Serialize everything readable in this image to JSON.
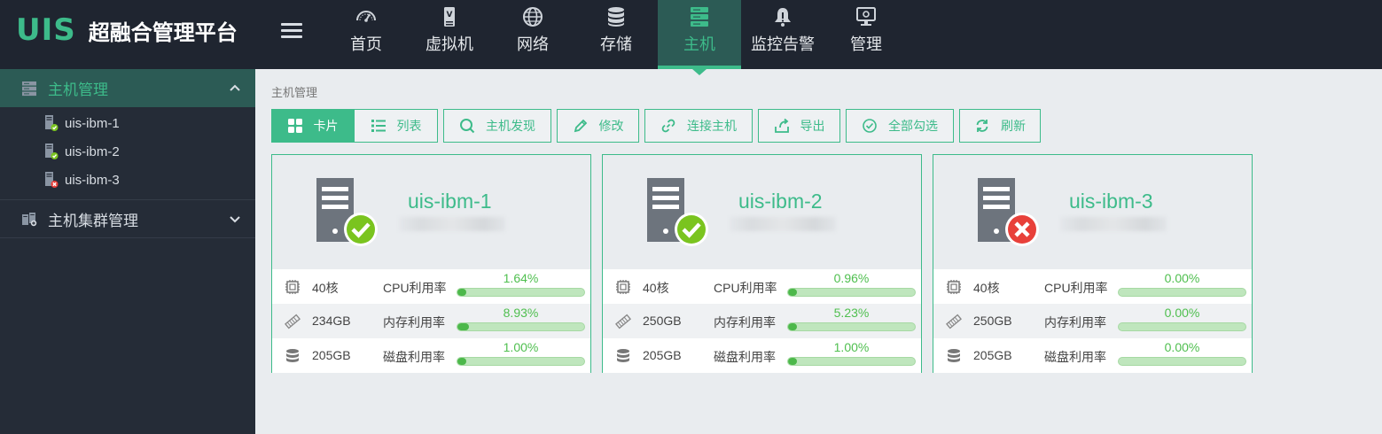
{
  "app": {
    "logo_mark": "UIS",
    "title": "超融合管理平台"
  },
  "nav": [
    {
      "label": "首页",
      "icon": "dashboard-icon",
      "active": false
    },
    {
      "label": "虚拟机",
      "icon": "vm-icon",
      "active": false
    },
    {
      "label": "网络",
      "icon": "globe-icon",
      "active": false
    },
    {
      "label": "存储",
      "icon": "database-icon",
      "active": false
    },
    {
      "label": "主机",
      "icon": "server-icon",
      "active": true
    },
    {
      "label": "监控告警",
      "icon": "bell-icon",
      "active": false
    },
    {
      "label": "管理",
      "icon": "monitor-icon",
      "active": false
    }
  ],
  "sidebar": {
    "group1": {
      "label": "主机管理",
      "icon": "server-rack-icon",
      "expanded": true
    },
    "hosts": [
      {
        "label": "uis-ibm-1",
        "status": "ok"
      },
      {
        "label": "uis-ibm-2",
        "status": "ok"
      },
      {
        "label": "uis-ibm-3",
        "status": "error"
      }
    ],
    "group2": {
      "label": "主机集群管理",
      "icon": "cluster-icon",
      "expanded": false
    }
  },
  "breadcrumb": "主机管理",
  "toolbar": {
    "card_view": "卡片",
    "list_view": "列表",
    "discover": "主机发现",
    "edit": "修改",
    "connect": "连接主机",
    "export": "导出",
    "select_all": "全部勾选",
    "refresh": "刷新"
  },
  "cards": [
    {
      "name": "uis-ibm-1",
      "status": "ok",
      "cpu": {
        "value": "40核",
        "label": "CPU利用率",
        "pct": "1.64%",
        "frac": 0.0164
      },
      "mem": {
        "value": "234GB",
        "label": "内存利用率",
        "pct": "8.93%",
        "frac": 0.0893
      },
      "disk": {
        "value": "205GB",
        "label": "磁盘利用率",
        "pct": "1.00%",
        "frac": 0.01
      }
    },
    {
      "name": "uis-ibm-2",
      "status": "ok",
      "cpu": {
        "value": "40核",
        "label": "CPU利用率",
        "pct": "0.96%",
        "frac": 0.0096
      },
      "mem": {
        "value": "250GB",
        "label": "内存利用率",
        "pct": "5.23%",
        "frac": 0.0523
      },
      "disk": {
        "value": "205GB",
        "label": "磁盘利用率",
        "pct": "1.00%",
        "frac": 0.01
      }
    },
    {
      "name": "uis-ibm-3",
      "status": "error",
      "cpu": {
        "value": "40核",
        "label": "CPU利用率",
        "pct": "0.00%",
        "frac": 0
      },
      "mem": {
        "value": "250GB",
        "label": "内存利用率",
        "pct": "0.00%",
        "frac": 0
      },
      "disk": {
        "value": "205GB",
        "label": "磁盘利用率",
        "pct": "0.00%",
        "frac": 0
      }
    }
  ],
  "colors": {
    "accent": "#3dbb8a",
    "topbar": "#1f2530",
    "sidebar": "#252c37",
    "ok": "#7ac41f",
    "error": "#e8403a"
  }
}
